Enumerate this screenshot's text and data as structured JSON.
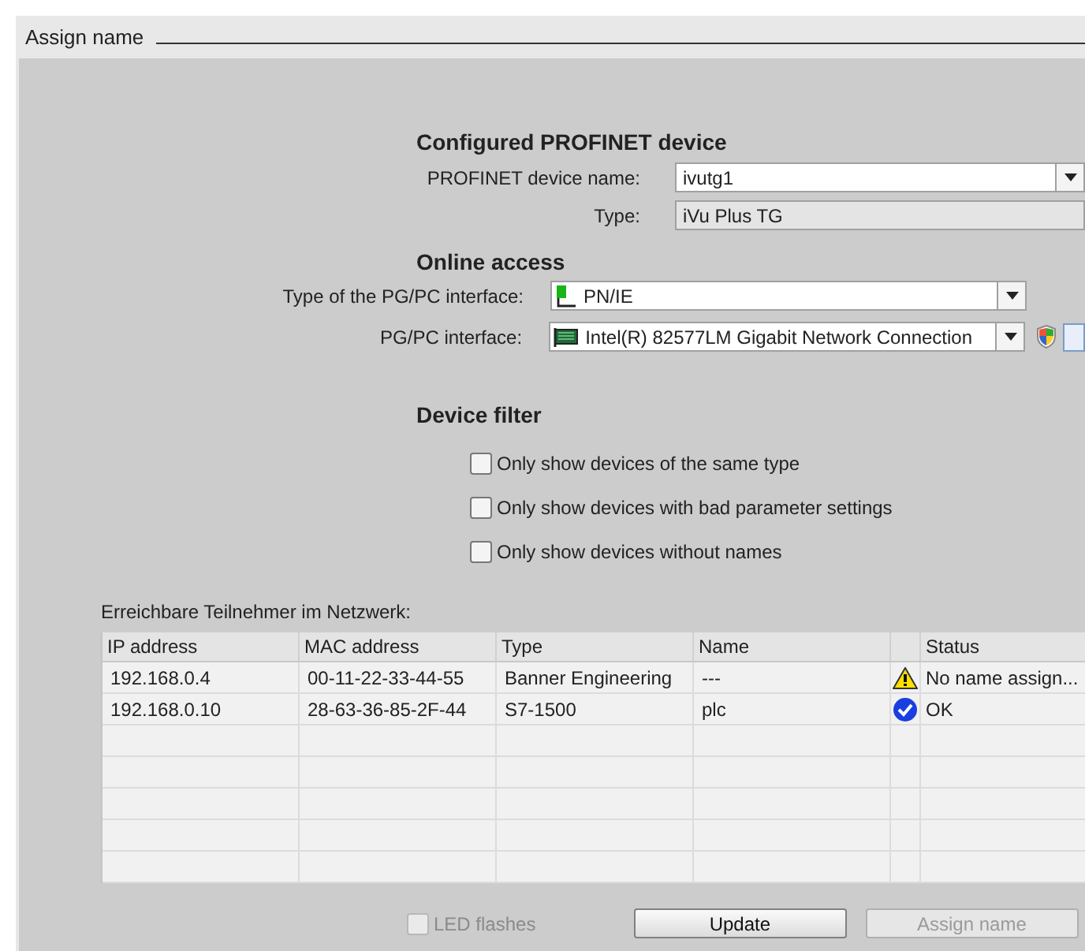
{
  "dialog": {
    "title": "Assign name"
  },
  "configured_device": {
    "heading": "Configured PROFINET device",
    "fields": [
      {
        "label": "PROFINET device name:",
        "value": "ivutg1",
        "kind": "dropdown"
      },
      {
        "label": "Type:",
        "value": "iVu Plus TG",
        "kind": "readonly"
      }
    ]
  },
  "online_access": {
    "heading": "Online access",
    "fields": [
      {
        "label": "Type of the PG/PC interface:",
        "value": "PN/IE",
        "kind": "dropdown"
      },
      {
        "label": "PG/PC interface:",
        "value": "Intel(R) 82577LM Gigabit Network Connection",
        "kind": "dropdown"
      }
    ]
  },
  "device_filter": {
    "heading": "Device filter",
    "options": [
      {
        "label": "Only show devices of the same type",
        "checked": false
      },
      {
        "label": "Only show devices with bad parameter settings",
        "checked": false
      },
      {
        "label": "Only show devices without names",
        "checked": false
      }
    ]
  },
  "table": {
    "caption": "Erreichbare Teilnehmer im Netzwerk:",
    "columns": [
      "IP address",
      "MAC address",
      "Type",
      "Name",
      "Status"
    ],
    "rows": [
      {
        "ip": "192.168.0.4",
        "mac": "00-11-22-33-44-55",
        "type": "Banner Engineering",
        "name": "---",
        "kind": "warning",
        "status": "No name assign..."
      },
      {
        "ip": "192.168.0.10",
        "mac": "28-63-36-85-2F-44",
        "type": "S7-1500",
        "name": "plc",
        "kind": "ok",
        "status": "OK"
      }
    ]
  },
  "footer": {
    "led_flashes": {
      "label": "LED flashes",
      "checked": false,
      "disabled": true
    },
    "buttons": [
      {
        "label": "Update",
        "disabled": false
      },
      {
        "label": "Assign name",
        "disabled": true
      }
    ]
  }
}
